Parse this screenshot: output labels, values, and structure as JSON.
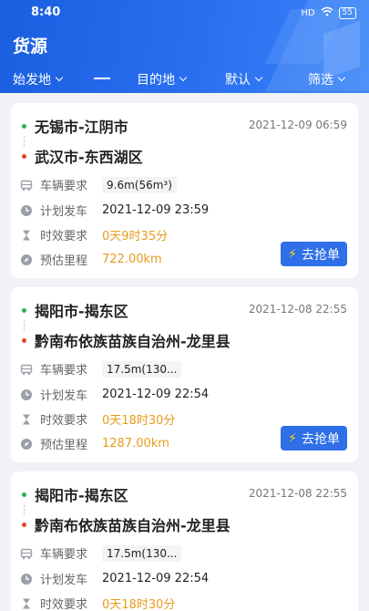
{
  "status_bar": {
    "time": "8:40",
    "signal_label": "HD",
    "battery": "55"
  },
  "header": {
    "title": "货源",
    "filters": {
      "origin": "始发地",
      "destination": "目的地",
      "sort": "默认",
      "screen": "筛选"
    }
  },
  "labels": {
    "vehicle": "车辆要求",
    "plan_depart": "计划发车",
    "time_limit": "时效要求",
    "est_distance": "预估里程",
    "grab": "去抢单"
  },
  "cards": [
    {
      "from": "无锡市-江阴市",
      "to": "武汉市-东西湖区",
      "posted": "2021-12-09 06:59",
      "vehicle": "9.6m(56m³)",
      "depart": "2021-12-09 23:59",
      "time_limit": "0天9时35分",
      "distance": "722.00km"
    },
    {
      "from": "揭阳市-揭东区",
      "to": "黔南布依族苗族自治州-龙里县",
      "posted": "2021-12-08 22:55",
      "vehicle": "17.5m(130...",
      "depart": "2021-12-09 22:54",
      "time_limit": "0天18时30分",
      "distance": "1287.00km"
    },
    {
      "from": "揭阳市-揭东区",
      "to": "黔南布依族苗族自治州-龙里县",
      "posted": "2021-12-08 22:55",
      "vehicle": "17.5m(130...",
      "depart": "2021-12-09 22:54",
      "time_limit": "0天18时30分"
    }
  ],
  "colors": {
    "brand_blue": "#2f6fe8",
    "accent_orange": "#e89b1b",
    "origin_dot": "#2bb34a",
    "dest_dot": "#e54335"
  }
}
